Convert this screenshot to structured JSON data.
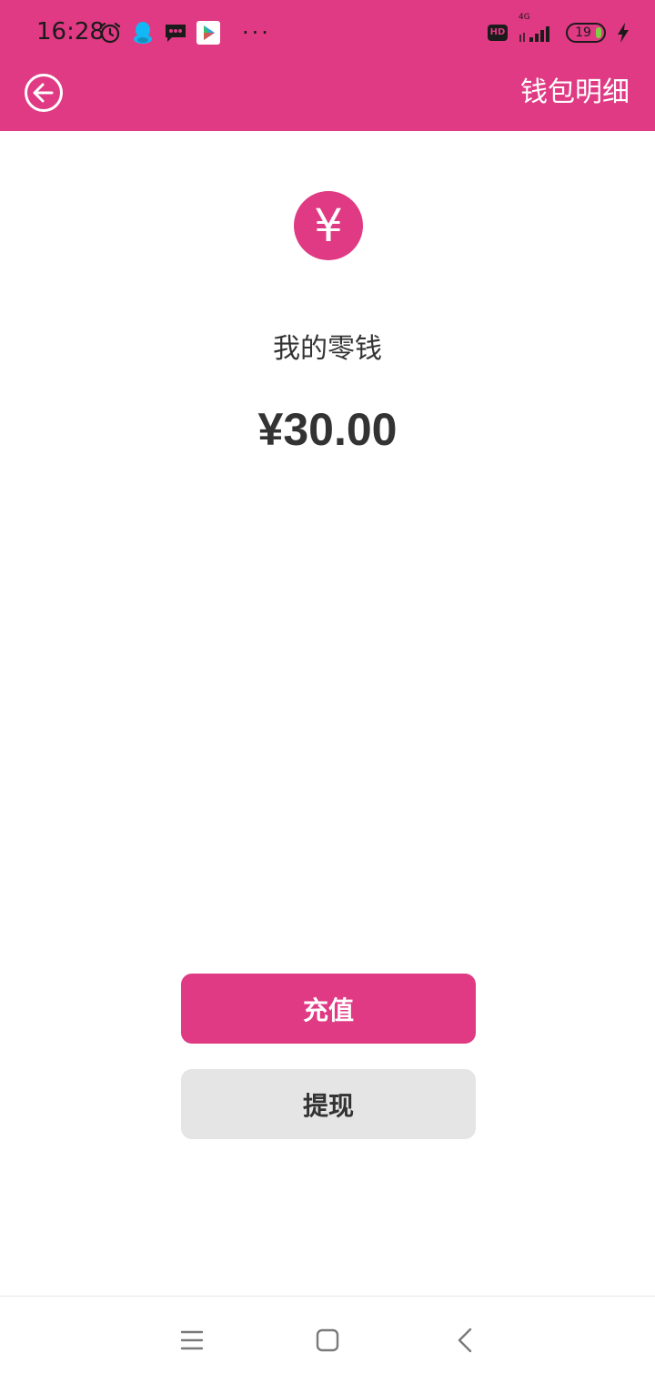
{
  "status_bar": {
    "time": "16:28",
    "battery_level": "19",
    "network": "4G",
    "more_indicator": "···",
    "hd_label": "HD",
    "icons_left": [
      "alarm-icon",
      "qq-icon",
      "message-icon",
      "play-store-icon"
    ],
    "icons_right": [
      "hd-icon",
      "signal-icon",
      "battery-icon",
      "charging-icon"
    ]
  },
  "header": {
    "title": "钱包明细",
    "back_icon": "back-arrow-icon"
  },
  "wallet": {
    "label": "我的零钱",
    "balance": "¥30.00",
    "coin_symbol": "¥",
    "coin_icon": "yuan-coin-icon"
  },
  "actions": {
    "recharge_label": "充值",
    "withdraw_label": "提现"
  },
  "nav": {
    "items": [
      "menu-icon",
      "home-icon",
      "back-icon"
    ]
  },
  "colors": {
    "brand": "#df3a83",
    "secondary_button": "#e5e5e5",
    "text_dark": "#333333",
    "battery_green": "#7ccf43"
  }
}
